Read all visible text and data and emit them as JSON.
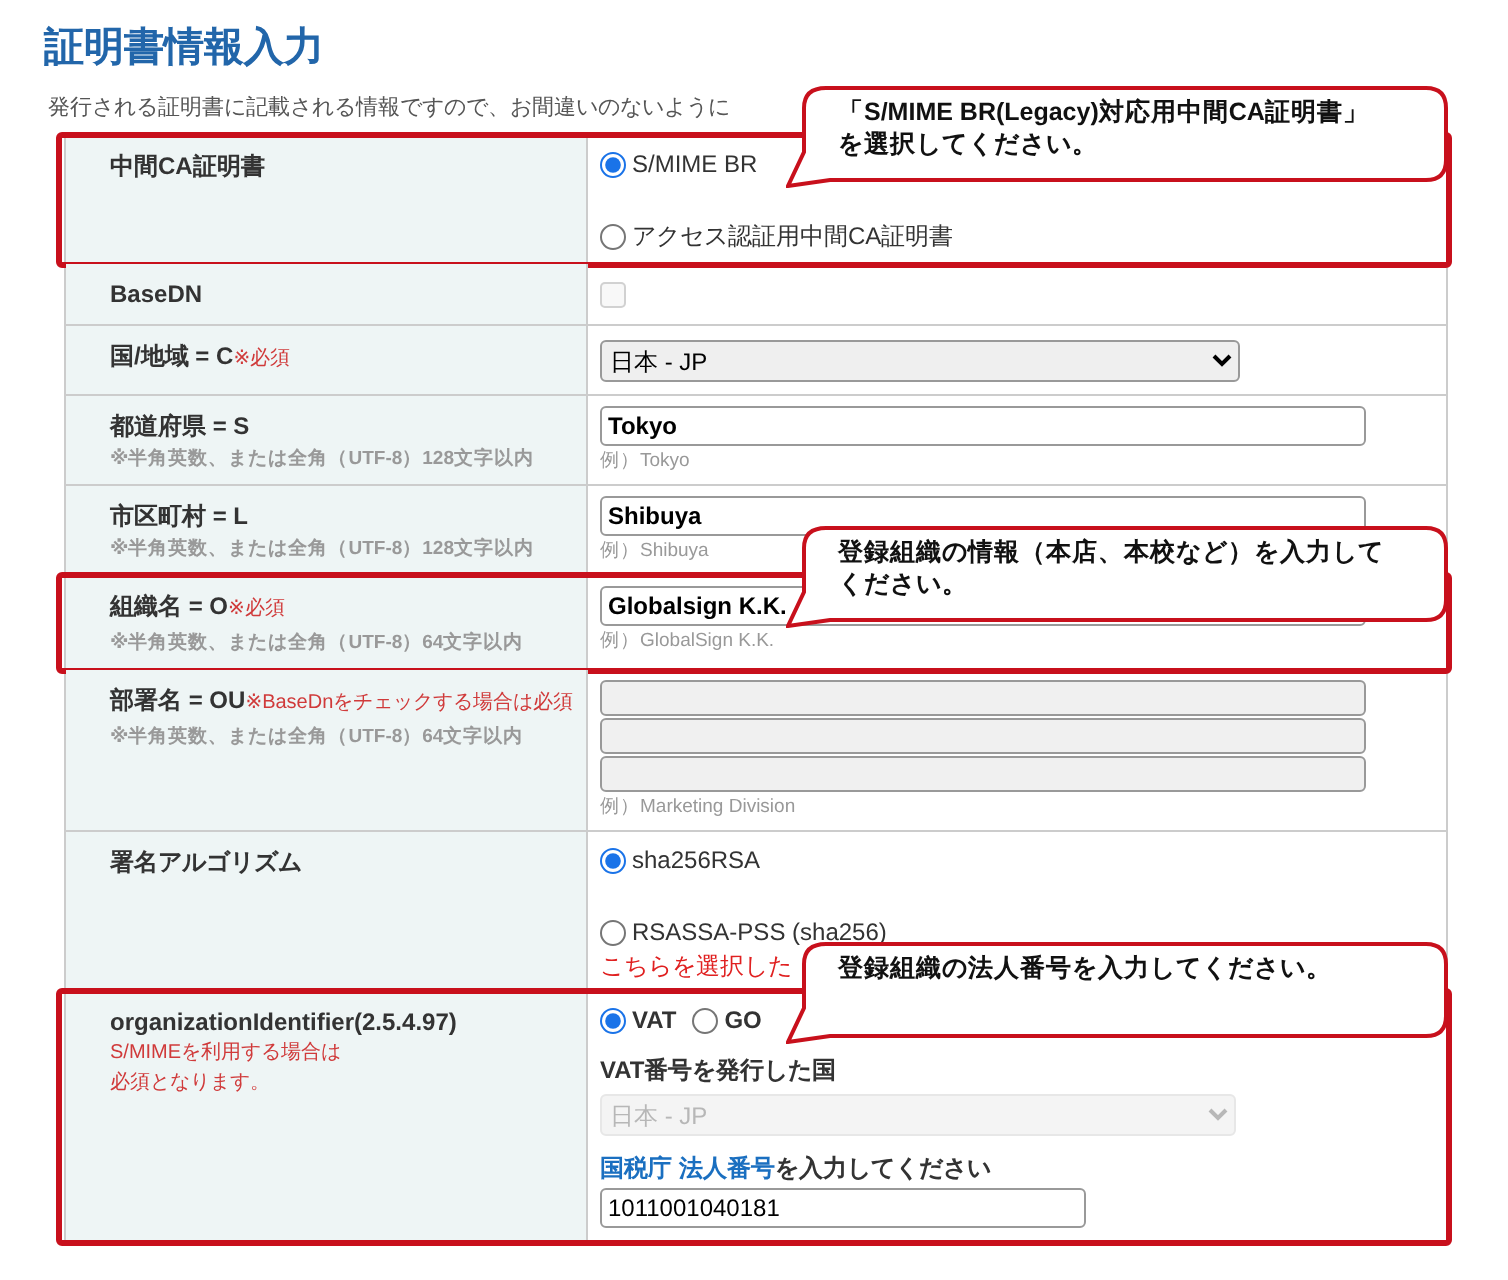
{
  "title": "証明書情報入力",
  "intro": "発行される証明書に記載される情報ですので、お間違いのないように",
  "rows": [
    {
      "kind": "radio",
      "label": "中間CA証明書",
      "highlighted": true,
      "callout": [
        "「S/MIME BR(Legacy)対応用中間CA証明書」",
        "を選択してください。"
      ],
      "options": [
        {
          "label": "S/MIME BR",
          "selected": true
        },
        {
          "label": "アクセス認証用中間CA証明書",
          "selected": false
        }
      ]
    },
    {
      "kind": "checkbox",
      "label": "BaseDN",
      "checked": false,
      "disabled": true
    },
    {
      "kind": "select",
      "label": "国/地域 = C",
      "required": "※必須",
      "value": "日本 - JP"
    },
    {
      "kind": "text",
      "label": "都道府県 = S",
      "note": "※半角英数、または全角（UTF-8）128文字以内",
      "value": "Tokyo",
      "example": "例）Tokyo"
    },
    {
      "kind": "text",
      "label": "市区町村 = L",
      "note": "※半角英数、または全角（UTF-8）128文字以内",
      "value": "Shibuya",
      "example": "例）Shibuya"
    },
    {
      "kind": "text",
      "label": "組織名 = O",
      "required": "※必須",
      "note": "※半角英数、または全角（UTF-8）64文字以内",
      "value": "Globalsign K.K.",
      "example": "例）GlobalSign K.K.",
      "highlighted": true,
      "callout": [
        "登録組織の情報（本店、本校など）を入力して",
        "ください。"
      ]
    },
    {
      "kind": "multi",
      "label": "部署名 = OU",
      "required": "※BaseDnをチェックする場合は必須",
      "note": "※半角英数、または全角（UTF-8）64文字以内",
      "fields": [
        {
          "disabled": true
        },
        {
          "disabled": true
        },
        {
          "disabled": true
        }
      ],
      "example": "例）Marketing Division"
    },
    {
      "kind": "radio",
      "label": "署名アルゴリズム",
      "options": [
        {
          "label": "sha256RSA",
          "selected": true
        },
        {
          "label": "RSASSA-PSS (sha256)",
          "selected": false
        }
      ],
      "warning": "こちらを選択した"
    },
    {
      "kind": "orgid",
      "label": "organizationIdentifier(2.5.4.97)",
      "notes": [
        "S/MIMEを利用する場合は",
        "必須となります。"
      ],
      "highlighted": true,
      "callout": [
        "登録組織の法人番号を入力してください。"
      ],
      "options": [
        {
          "label": "VAT",
          "selected": true
        },
        {
          "label": "GO",
          "selected": false
        }
      ],
      "country_label": "VAT番号を発行した国",
      "country": {
        "value": "日本 - JP",
        "disabled": true
      },
      "prompt": {
        "links": [
          "国税庁",
          "法人番号"
        ],
        "text": "を入力してください"
      },
      "value": "1011001040181"
    }
  ]
}
